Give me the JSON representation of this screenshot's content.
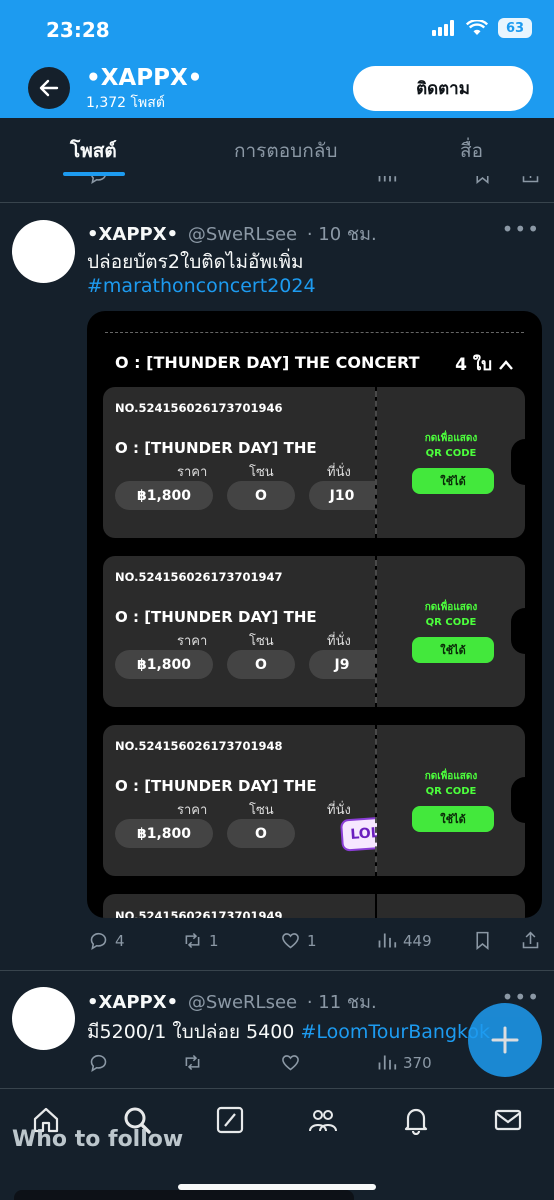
{
  "status_bar": {
    "time": "23:28",
    "battery": "63"
  },
  "header": {
    "profile_name": "•XAPPX•",
    "post_count": "1,372 โพสต์",
    "follow_label": "ติดตาม",
    "accent_color": "#1d9bf0"
  },
  "tabs": [
    {
      "label": "โพสต์",
      "active": true
    },
    {
      "label": "การตอบกลับ",
      "active": false
    },
    {
      "label": "สื่อ",
      "active": false
    }
  ],
  "tweets": [
    {
      "name": "•XAPPX•",
      "handle": "@SweRLsee",
      "time": "· 10 ชม.",
      "text": "ปล่อยบัตร2ใบติดไม่อัพเพิ่ม",
      "hashtag": "#marathonconcert2024",
      "media": {
        "concert_title": "O : [THUNDER DAY] THE CONCERT",
        "ticket_count": "4 ใบ",
        "tickets": [
          {
            "number": "NO.524156026173701946",
            "title": "O : [THUNDER DAY] THE",
            "price_label": "ราคา",
            "zone_label": "โซน",
            "seat_label": "ที่นั่ง",
            "price": "฿1,800",
            "zone": "O",
            "seat": "J10",
            "show_qr": "กดเพื่อแสดง",
            "qr_code": "QR CODE",
            "use_label": "ใช้ได้"
          },
          {
            "number": "NO.524156026173701947",
            "title": "O : [THUNDER DAY] THE",
            "price_label": "ราคา",
            "zone_label": "โซน",
            "seat_label": "ที่นั่ง",
            "price": "฿1,800",
            "zone": "O",
            "seat": "J9",
            "show_qr": "กดเพื่อแสดง",
            "qr_code": "QR CODE",
            "use_label": "ใช้ได้"
          },
          {
            "number": "NO.524156026173701948",
            "title": "O : [THUNDER DAY] THE",
            "price_label": "ราคา",
            "zone_label": "โซน",
            "seat_label": "ที่นั่ง",
            "price": "฿1,800",
            "zone": "O",
            "seat": "",
            "sticker": "LOL",
            "show_qr": "กดเพื่อแสดง",
            "qr_code": "QR CODE",
            "use_label": "ใช้ได้"
          },
          {
            "number": "NO.524156026173701949"
          }
        ]
      },
      "actions": {
        "replies": "4",
        "retweets": "1",
        "likes": "1",
        "views": "449"
      }
    },
    {
      "name": "•XAPPX•",
      "handle": "@SweRLsee",
      "time": "· 11 ชม.",
      "text": "มี5200/1 ใบปล่อย 5400",
      "hashtag": "#LoomTourBangkok",
      "actions": {
        "views": "370"
      }
    }
  ],
  "fab": {
    "icon": "plus-icon"
  },
  "overlay": {
    "who_to_follow": "Who to follow"
  },
  "bottom_nav": [
    "home-icon",
    "search-icon",
    "grok-icon",
    "communities-icon",
    "notifications-icon",
    "messages-icon"
  ]
}
